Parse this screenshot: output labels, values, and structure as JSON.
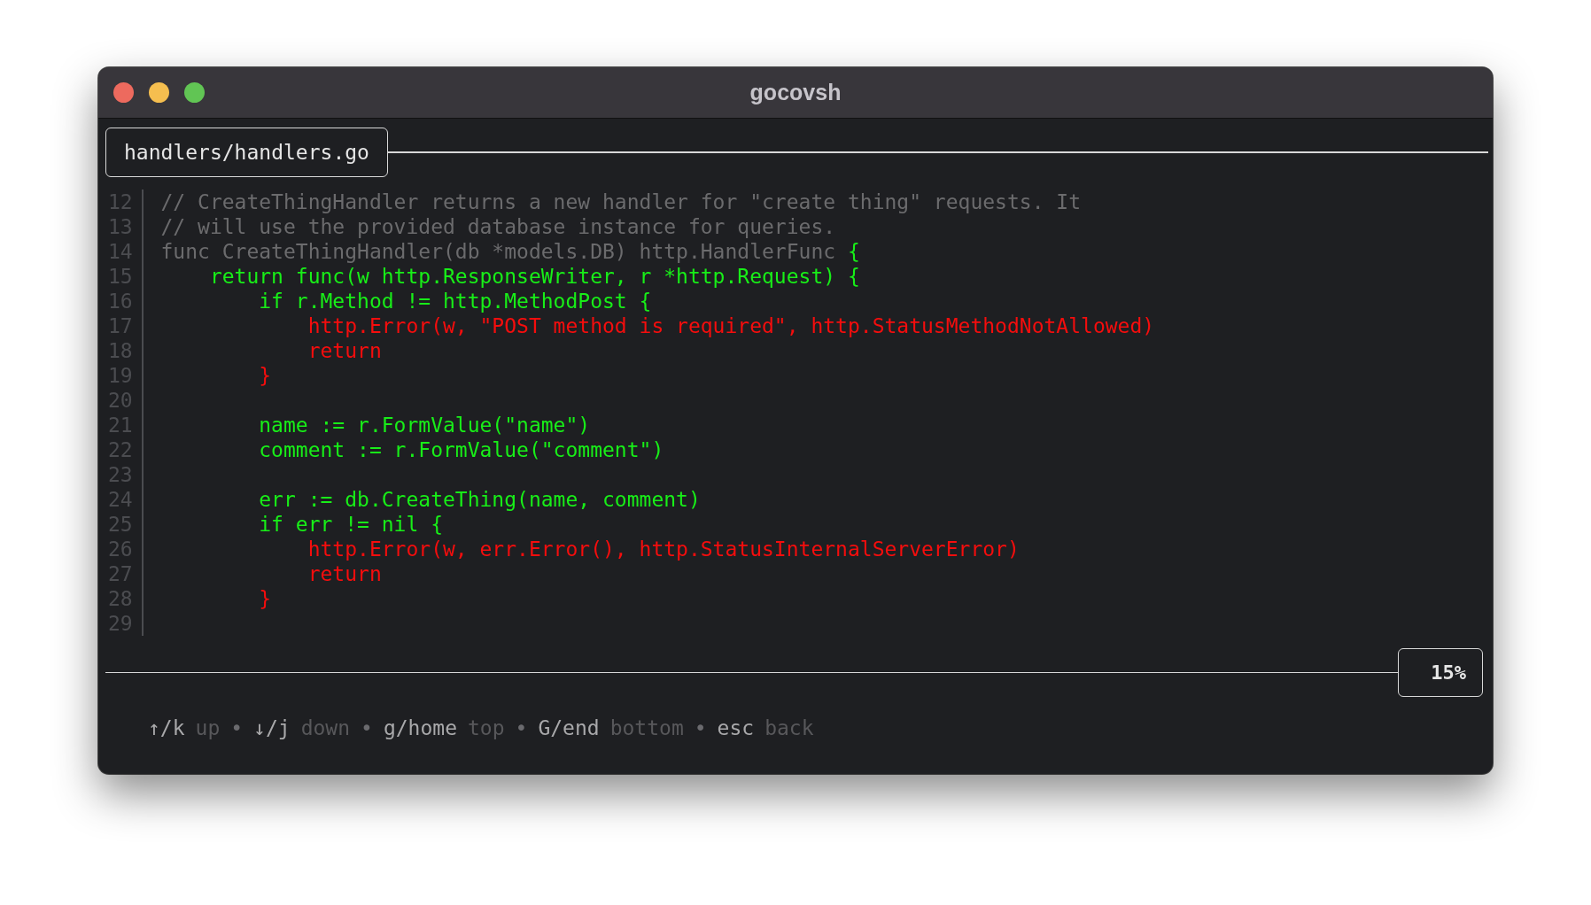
{
  "window": {
    "title": "gocovsh"
  },
  "file_tab": {
    "label": "handlers/handlers.go"
  },
  "code_lines": [
    {
      "number": "12",
      "segments": [
        {
          "text": "// CreateThingHandler returns a new handler for \"create thing\" requests. It",
          "kind": "plain"
        }
      ]
    },
    {
      "number": "13",
      "segments": [
        {
          "text": "// will use the provided database instance for queries.",
          "kind": "plain"
        }
      ]
    },
    {
      "number": "14",
      "segments": [
        {
          "text": "func CreateThingHandler(db *models.DB) http.HandlerFunc ",
          "kind": "plain"
        },
        {
          "text": "{",
          "kind": "covered"
        }
      ]
    },
    {
      "number": "15",
      "segments": [
        {
          "text": "    return func(w http.ResponseWriter, r *http.Request) {",
          "kind": "covered"
        }
      ]
    },
    {
      "number": "16",
      "segments": [
        {
          "text": "        if r.Method != http.MethodPost {",
          "kind": "covered"
        }
      ]
    },
    {
      "number": "17",
      "segments": [
        {
          "text": "            http.Error(w, \"POST method is required\", http.StatusMethodNotAllowed)",
          "kind": "uncovered"
        }
      ]
    },
    {
      "number": "18",
      "segments": [
        {
          "text": "            return",
          "kind": "uncovered"
        }
      ]
    },
    {
      "number": "19",
      "segments": [
        {
          "text": "        }",
          "kind": "uncovered"
        }
      ]
    },
    {
      "number": "20"
    },
    {
      "number": "21",
      "segments": [
        {
          "text": "        name := r.FormValue(\"name\")",
          "kind": "covered"
        }
      ]
    },
    {
      "number": "22",
      "segments": [
        {
          "text": "        comment := r.FormValue(\"comment\")",
          "kind": "covered"
        }
      ]
    },
    {
      "number": "23"
    },
    {
      "number": "24",
      "segments": [
        {
          "text": "        err := db.CreateThing(name, comment)",
          "kind": "covered"
        }
      ]
    },
    {
      "number": "25",
      "segments": [
        {
          "text": "        if err != nil {",
          "kind": "covered"
        }
      ]
    },
    {
      "number": "26",
      "segments": [
        {
          "text": "            http.Error(w, err.Error(), http.StatusInternalServerError)",
          "kind": "uncovered"
        }
      ]
    },
    {
      "number": "27",
      "segments": [
        {
          "text": "            return",
          "kind": "uncovered"
        }
      ]
    },
    {
      "number": "28",
      "segments": [
        {
          "text": "        }",
          "kind": "uncovered"
        }
      ]
    },
    {
      "number": "29"
    }
  ],
  "scroll_percent": "15%",
  "help": [
    {
      "text": "↑/k",
      "kind": "key"
    },
    {
      "text": "up",
      "kind": "action"
    },
    {
      "text": "•",
      "kind": "separator"
    },
    {
      "text": "↓/j",
      "kind": "key"
    },
    {
      "text": "down",
      "kind": "action"
    },
    {
      "text": "•",
      "kind": "separator"
    },
    {
      "text": "g/home",
      "kind": "key"
    },
    {
      "text": "top",
      "kind": "action"
    },
    {
      "text": "•",
      "kind": "separator"
    },
    {
      "text": "G/end",
      "kind": "key"
    },
    {
      "text": "bottom",
      "kind": "action"
    },
    {
      "text": "•",
      "kind": "separator"
    },
    {
      "text": "esc",
      "kind": "key"
    },
    {
      "text": "back",
      "kind": "action"
    }
  ]
}
